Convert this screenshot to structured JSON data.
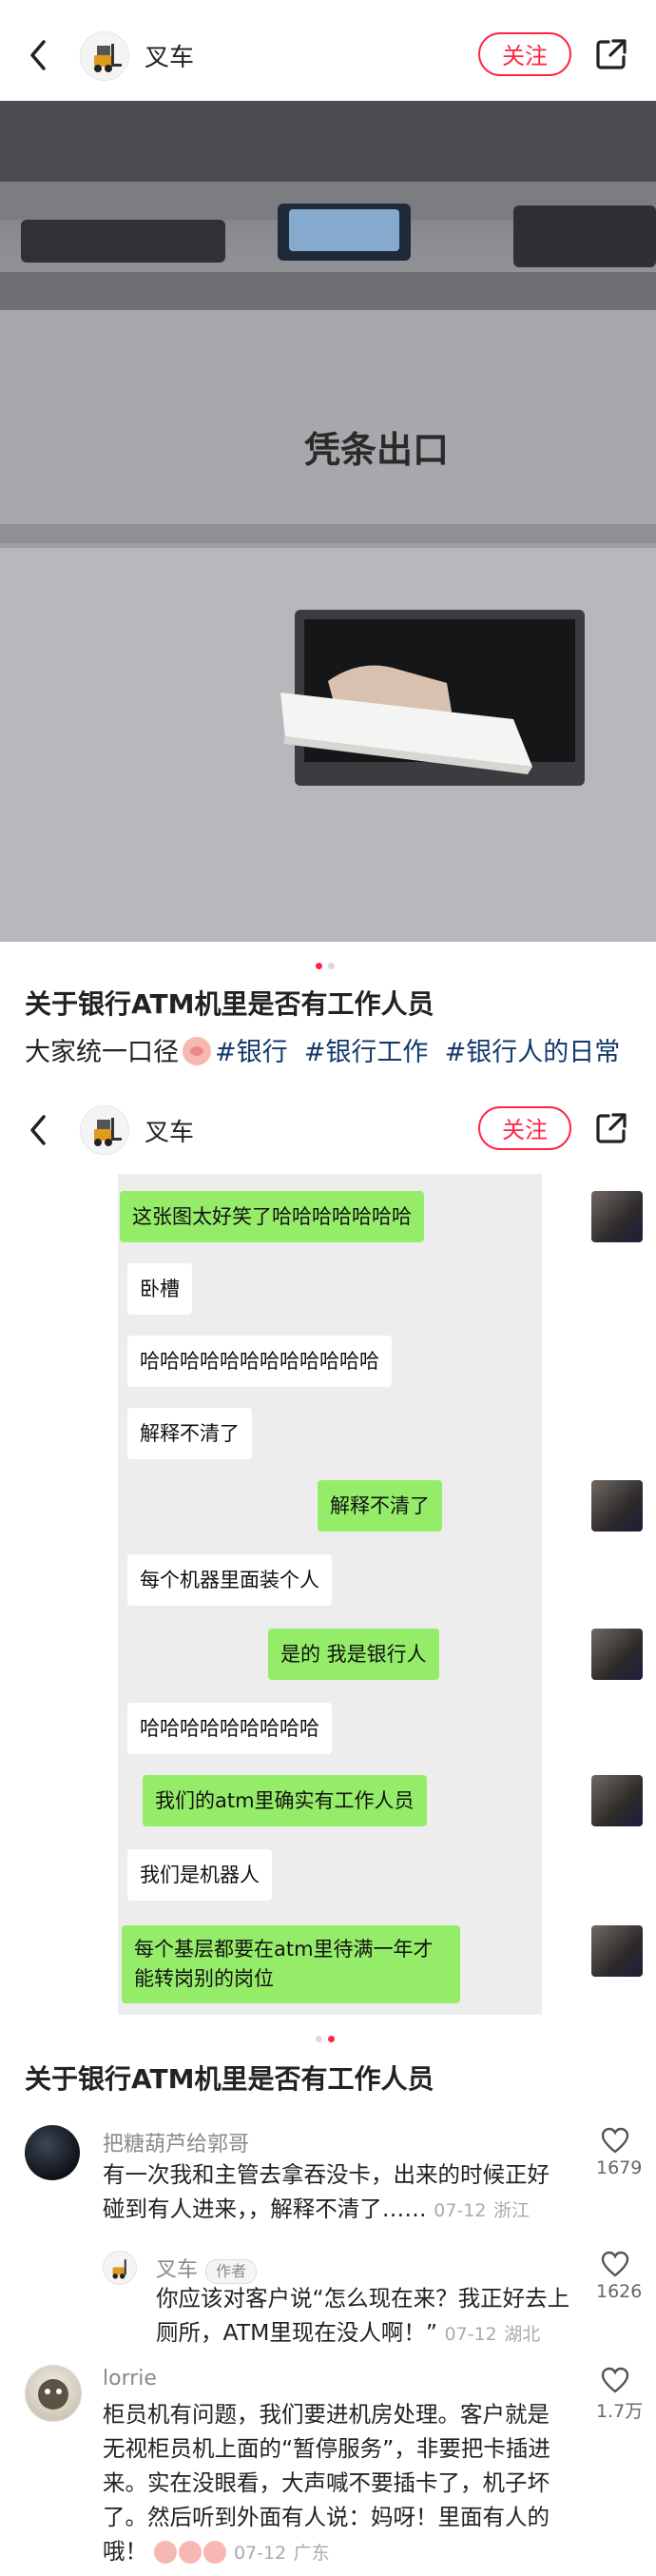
{
  "header": {
    "author": "叉车",
    "follow_label": "关注"
  },
  "photo": {
    "label_printed": "凭条出口",
    "slide_count": 2,
    "active_index": 0
  },
  "post": {
    "title": "关于银行ATM机里是否有工作人员",
    "desc_text": "大家统一口径",
    "tags": [
      "#银行",
      "#银行工作",
      "#银行人的日常"
    ]
  },
  "second_slide": {
    "header": {
      "author": "叉车",
      "follow_label": "关注"
    },
    "chat": [
      {
        "side": "right",
        "text": "这张图太好笑了哈哈哈哈哈哈哈"
      },
      {
        "side": "left",
        "text": "卧槽"
      },
      {
        "side": "left",
        "text": "哈哈哈哈哈哈哈哈哈哈哈哈"
      },
      {
        "side": "left",
        "text": "解释不清了"
      },
      {
        "side": "right",
        "text": "解释不清了"
      },
      {
        "side": "left",
        "text": "每个机器里面装个人"
      },
      {
        "side": "right",
        "text": "是的 我是银行人"
      },
      {
        "side": "left",
        "text": "哈哈哈哈哈哈哈哈哈"
      },
      {
        "side": "right",
        "text": "我们的atm里确实有工作人员"
      },
      {
        "side": "left",
        "text": "我们是机器人"
      },
      {
        "side": "right",
        "text": "每个基层都要在atm里待满一年才能转岗别的岗位"
      }
    ],
    "title": "关于银行ATM机里是否有工作人员"
  },
  "comments": [
    {
      "name": "把糖葫芦给郭哥",
      "text": "有一次我和主管去拿吞没卡，出来的时候正好碰到有人进来，，解释不清了……",
      "date": "07-12",
      "location": "浙江",
      "likes": "1679"
    },
    {
      "name": "叉车",
      "badge": "作者",
      "text": "你应该对客户说“怎么现在来？我正好去上厕所，ATM里现在没人啊！”",
      "date": "07-12",
      "location": "湖北",
      "likes": "1626"
    },
    {
      "name": "lorrie",
      "text": "柜员机有问题，我们要进机房处理。客户就是无视柜员机上面的“暂停服务”，非要把卡插进来。实在没眼看，大声喊不要插卡了，机子坏了。然后听到外面有人说：妈呀！里面有人的哦！",
      "date": "07-12",
      "location": "广东",
      "likes": "1.7万"
    }
  ],
  "colors": {
    "accent": "#ff2442",
    "tag": "#13386c",
    "wechat_green": "#95ec69"
  }
}
